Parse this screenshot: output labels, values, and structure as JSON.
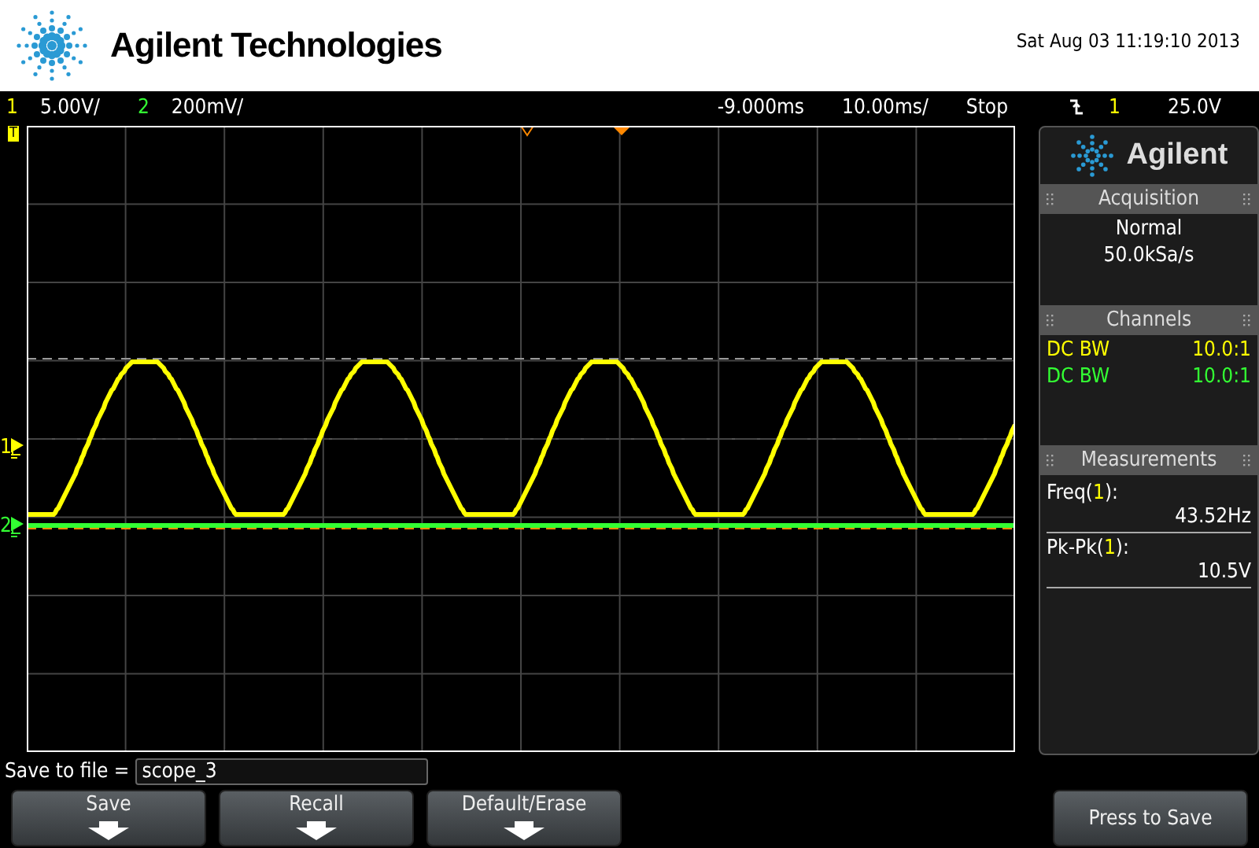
{
  "header": {
    "brand": "Agilent Technologies",
    "datetime": "Sat Aug 03 11:19:10 2013"
  },
  "status_bar": {
    "channels": [
      {
        "number": "1",
        "scale": "5.00V/",
        "color": "#ffff00"
      },
      {
        "number": "2",
        "scale": "200mV/",
        "color": "#33ff33"
      }
    ],
    "delay": "-9.000ms",
    "timebase": "10.00ms/",
    "run_state": "Stop",
    "trigger_source": "1",
    "trigger_level": "25.0V"
  },
  "graticule": {
    "trigger_marker": "T",
    "channel_markers": [
      {
        "number": "1",
        "color": "#ffff00"
      },
      {
        "number": "2",
        "color": "#33ff33"
      }
    ]
  },
  "panel": {
    "brand": "Agilent",
    "acquisition": {
      "title": "Acquisition",
      "mode": "Normal",
      "rate": "50.0kSa/s"
    },
    "channels": {
      "title": "Channels",
      "rows": [
        {
          "coupling": "DC BW",
          "probe": "10.0:1",
          "color": "#ffff00"
        },
        {
          "coupling": "DC BW",
          "probe": "10.0:1",
          "color": "#33ff33"
        }
      ]
    },
    "measurements": {
      "title": "Measurements",
      "items": [
        {
          "name": "Freq(",
          "source": "1",
          "close": "):",
          "value": "43.52Hz"
        },
        {
          "name": "Pk-Pk(",
          "source": "1",
          "close": "):",
          "value": "10.5V"
        }
      ]
    }
  },
  "save_row": {
    "label": "Save to file =",
    "value": "scope_3"
  },
  "softkeys": [
    {
      "label": "Save",
      "kind": "menu"
    },
    {
      "label": "Recall",
      "kind": "menu"
    },
    {
      "label": "Default/Erase",
      "kind": "menu"
    },
    {
      "label": "Press to Save",
      "kind": "action"
    }
  ]
}
